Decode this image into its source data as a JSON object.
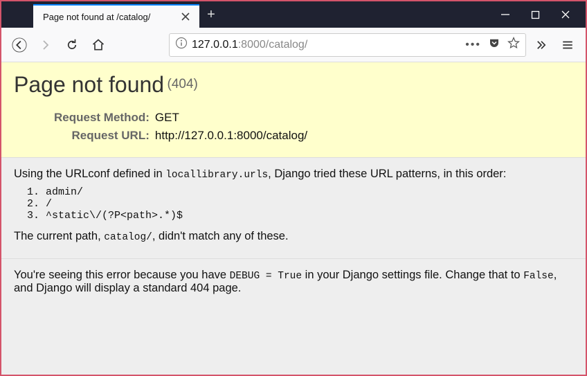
{
  "window": {
    "tab_title": "Page not found at /catalog/"
  },
  "toolbar": {
    "url_prefix": "127.0.0.1",
    "url_suffix": ":8000/catalog/"
  },
  "summary": {
    "heading": "Page not found",
    "status": "(404)",
    "request_method_label": "Request Method:",
    "request_method_value": "GET",
    "request_url_label": "Request URL:",
    "request_url_value": "http://127.0.0.1:8000/catalog/"
  },
  "info": {
    "intro_before": "Using the URLconf defined in ",
    "intro_code": "locallibrary.urls",
    "intro_after": ", Django tried these URL patterns, in this order:",
    "patterns": [
      "admin/",
      "/",
      "^static\\/(?P<path>.*)$"
    ],
    "outro_before": "The current path, ",
    "outro_code": "catalog/",
    "outro_after": ", didn't match any of these."
  },
  "explanation": {
    "before1": "You're seeing this error because you have ",
    "code1": "DEBUG = True",
    "mid": " in your Django settings file. Change that to ",
    "code2": "False",
    "after": ", and Django will display a standard 404 page."
  }
}
